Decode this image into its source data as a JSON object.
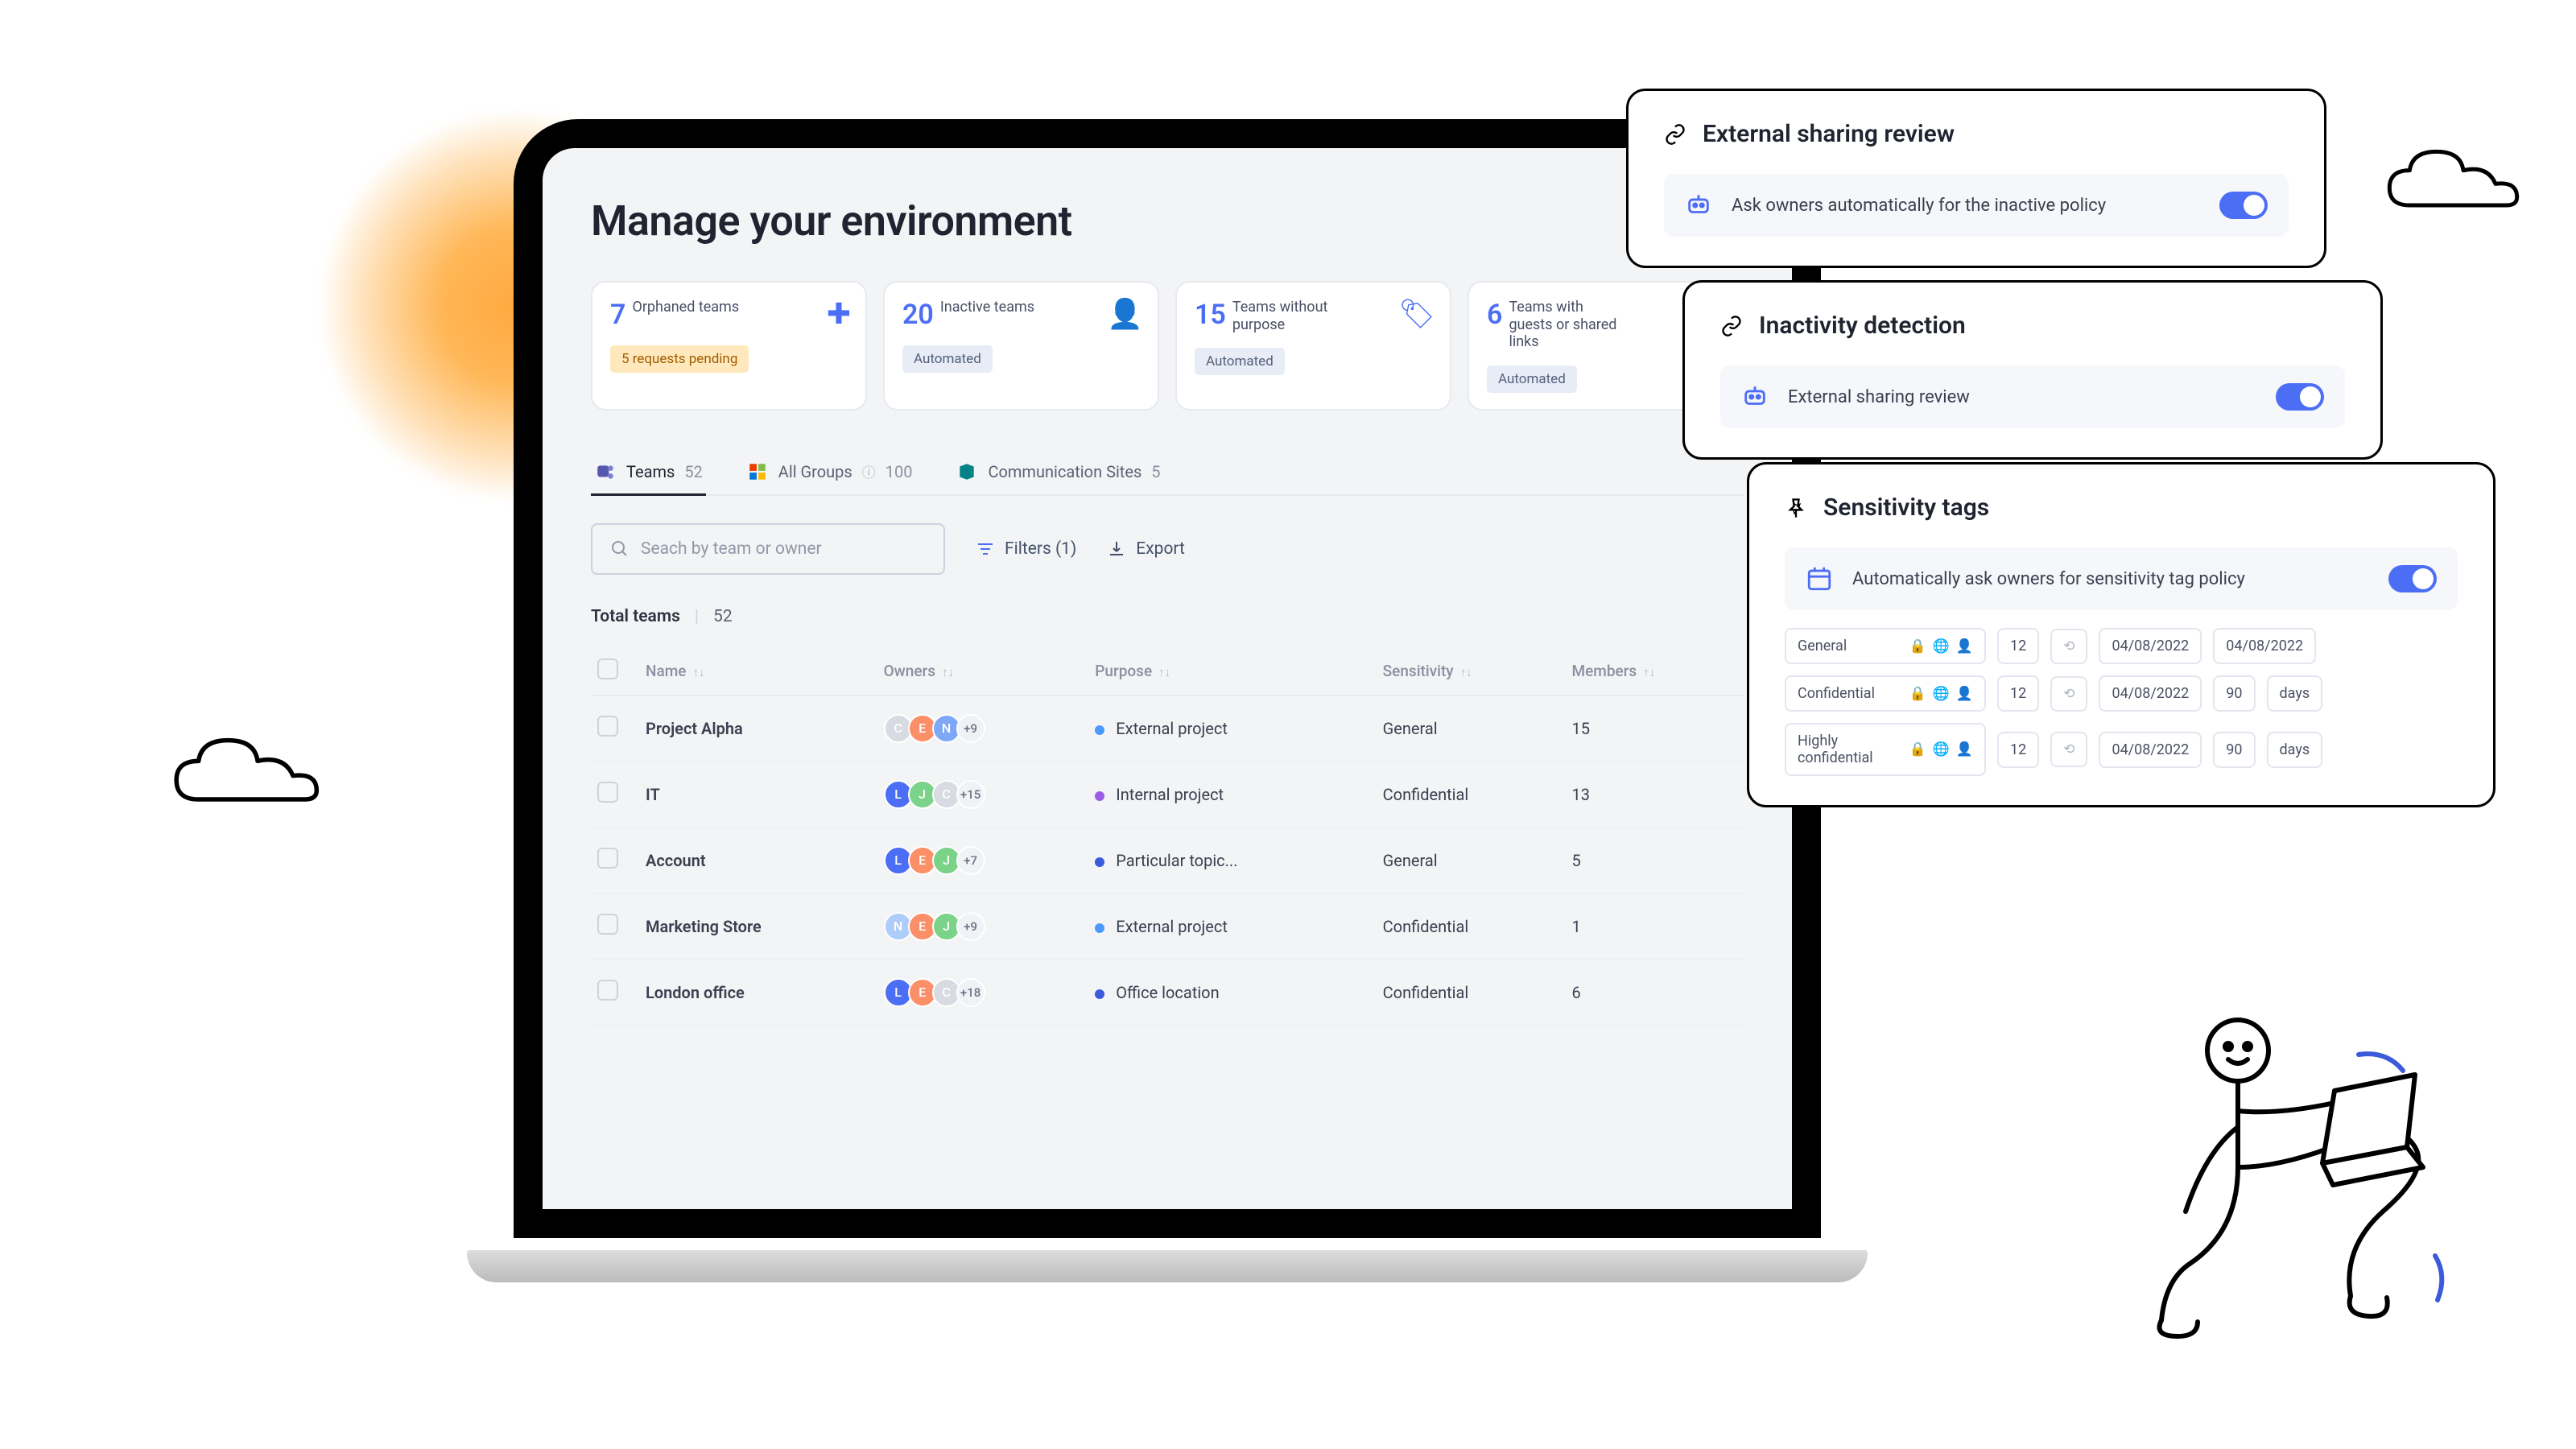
{
  "page_title": "Manage your environment",
  "scorecards": [
    {
      "count": "7",
      "label": "Orphaned teams",
      "badge": "5 requests pending",
      "badge_class": "orange"
    },
    {
      "count": "20",
      "label": "Inactive teams",
      "badge": "Automated",
      "badge_class": "blue"
    },
    {
      "count": "15",
      "label": "Teams without purpose",
      "badge": "Automated",
      "badge_class": "blue"
    },
    {
      "count": "6",
      "label": "Teams with guests or shared links",
      "badge": "Automated",
      "badge_class": "blue"
    }
  ],
  "tabs": [
    {
      "id": "teams",
      "label": "Teams",
      "count": "52",
      "active": true
    },
    {
      "id": "groups",
      "label": "All Groups",
      "count": "100",
      "active": false,
      "info": true
    },
    {
      "id": "sites",
      "label": "Communication Sites",
      "count": "5",
      "active": false
    }
  ],
  "search_placeholder": "Seach by team or owner",
  "filters_label": "Filters (1)",
  "export_label": "Export",
  "total_label": "Total teams",
  "total_count": "52",
  "columns": [
    "Name",
    "Owners",
    "Purpose",
    "Sensitivity",
    "Members"
  ],
  "rows": [
    {
      "name": "Project Alpha",
      "owners": [
        {
          "t": "C",
          "c": "#d8dbe2"
        },
        {
          "t": "E",
          "c": "#fb8f67"
        },
        {
          "t": "N",
          "c": "#7ea8f7"
        }
      ],
      "more": "+9",
      "purpose": "External project",
      "dot": "dot-blue",
      "sens": "General",
      "members": "15"
    },
    {
      "name": "IT",
      "owners": [
        {
          "t": "L",
          "c": "#4c6ef5"
        },
        {
          "t": "J",
          "c": "#7bd389"
        },
        {
          "t": "C",
          "c": "#d8dbe2"
        }
      ],
      "more": "+15",
      "purpose": "Internal project",
      "dot": "dot-purple",
      "sens": "Confidential",
      "members": "13"
    },
    {
      "name": "Account",
      "owners": [
        {
          "t": "L",
          "c": "#4c6ef5"
        },
        {
          "t": "E",
          "c": "#fb8f67"
        },
        {
          "t": "J",
          "c": "#7bd389"
        }
      ],
      "more": "+7",
      "purpose": "Particular topic...",
      "dot": "dot-navy",
      "sens": "General",
      "members": "5"
    },
    {
      "name": "Marketing Store",
      "owners": [
        {
          "t": "N",
          "c": "#aecdfb"
        },
        {
          "t": "E",
          "c": "#fb8f67"
        },
        {
          "t": "J",
          "c": "#7bd389"
        }
      ],
      "more": "+9",
      "purpose": "External project",
      "dot": "dot-blue",
      "sens": "Confidential",
      "members": "1"
    },
    {
      "name": "London office",
      "owners": [
        {
          "t": "L",
          "c": "#4c6ef5"
        },
        {
          "t": "E",
          "c": "#fb8f67"
        },
        {
          "t": "C",
          "c": "#d8dbe2"
        }
      ],
      "more": "+18",
      "purpose": "Office location",
      "dot": "dot-navy",
      "sens": "Confidential",
      "members": "6"
    }
  ],
  "policy1": {
    "title": "External sharing review",
    "desc": "Ask owners automatically for the inactive policy"
  },
  "policy2": {
    "title": "Inactivity detection",
    "desc": "External sharing review"
  },
  "policy3": {
    "title": "Sensitivity tags",
    "desc": "Automatically ask owners for sensitivity tag policy",
    "rows": [
      {
        "name": "General",
        "n": "12",
        "date": "04/08/2022",
        "date2": "04/08/2022",
        "duration": ""
      },
      {
        "name": "Confidential",
        "n": "12",
        "date": "04/08/2022",
        "dur_n": "90",
        "dur_u": "days"
      },
      {
        "name": "Highly confidential",
        "n": "12",
        "date": "04/08/2022",
        "dur_n": "90",
        "dur_u": "days"
      }
    ]
  }
}
